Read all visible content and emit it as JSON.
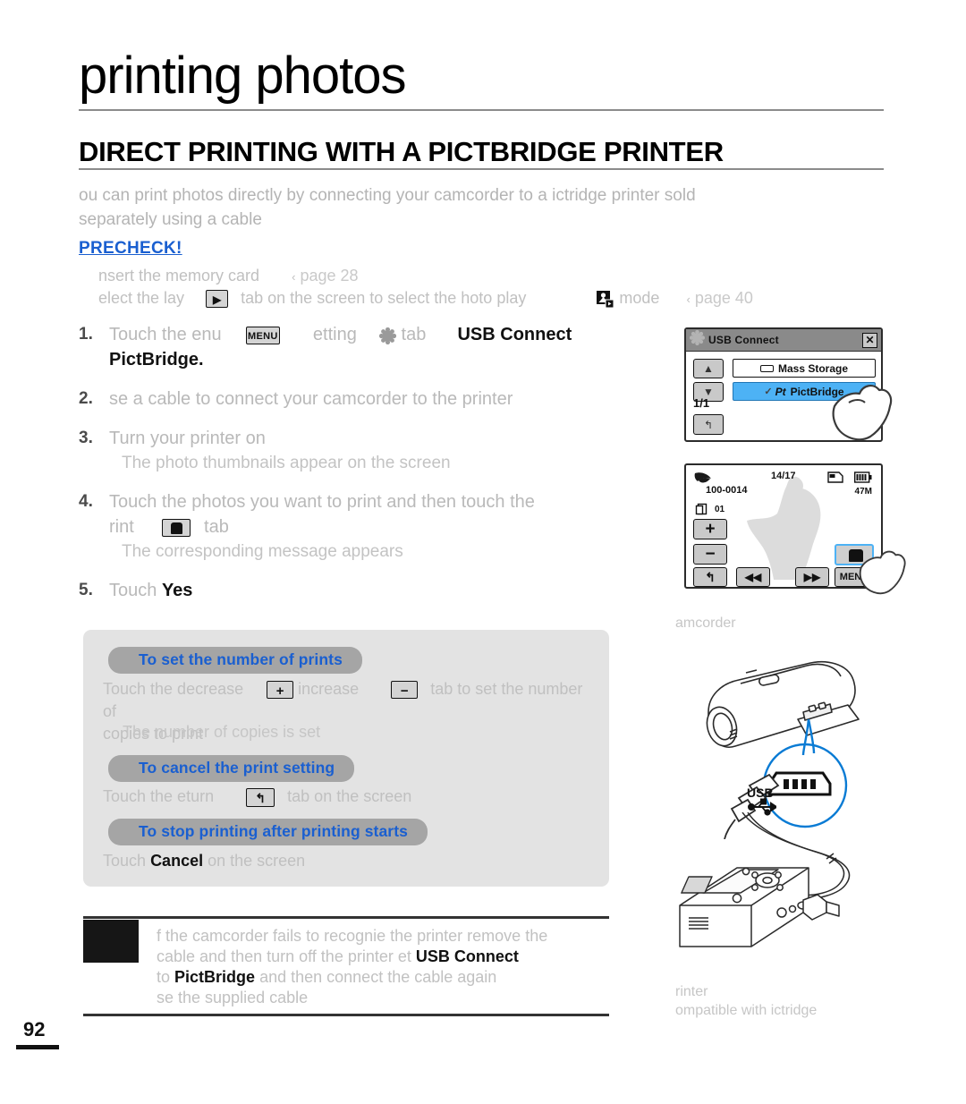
{
  "page": {
    "title": "printing photos",
    "section_title": "DIRECT PRINTING WITH A PICTBRIDGE PRINTER",
    "page_number": "92"
  },
  "intro": {
    "line1": "ou can print photos directly by connecting your camcorder to a ictridge printer sold",
    "line2": "separately using a  cable"
  },
  "precheck": {
    "label": "PRECHECK!",
    "items": [
      {
        "text": "nsert the memory card",
        "ref": "page 28",
        "icon": ""
      },
      {
        "text_before": "elect the lay",
        "icon": "play-tab-icon",
        "text_mid": "tab on the  screen to select the hoto play",
        "mode_icon": "photo-play-mode-icon",
        "text_after": "mode",
        "ref": "page 40"
      }
    ]
  },
  "steps": [
    {
      "num": "1.",
      "part1": "Touch the enu",
      "icon1": "menu-icon",
      "part2": "etting",
      "icon2": "settings-gear-icon",
      "part3": "tab",
      "bold1": "USB Connect",
      "bold2": "PictBridge."
    },
    {
      "num": "2.",
      "part1": "se a  cable to connect your camcorder to the printer"
    },
    {
      "num": "3.",
      "part1": "Turn your printer on",
      "sub": "The photo thumbnails appear on the  screen"
    },
    {
      "num": "4.",
      "part1": "Touch the photos you want to print and then touch the",
      "part2": "rint",
      "icon1": "print-tab-icon",
      "part3": "tab",
      "sub": "The corresponding message appears"
    },
    {
      "num": "5.",
      "part1": "Touch",
      "bold1": "Yes"
    }
  ],
  "infobox": {
    "blocks": [
      {
        "pill": "To set the number of prints",
        "line1a": "Touch the decrease",
        "icon1": "plus-tab-icon",
        "line1b": "increase",
        "icon2": "minus-tab-icon",
        "line1c": "tab to set the number of",
        "line2": "copies to print",
        "sub": "The number of copies is set"
      },
      {
        "pill": "To cancel the print setting",
        "line1a": "Touch the eturn",
        "icon1": "return-tab-icon",
        "line1b": "tab on the  screen"
      },
      {
        "pill": "To stop printing after printing starts",
        "line1a": "Touch",
        "bold": "Cancel",
        "line1b": "on the screen"
      }
    ]
  },
  "note": {
    "line1": "f the camcorder fails to recognie the printer remove the",
    "line2a": " cable and then turn off the printer et",
    "line2b": "USB Connect",
    "line3a": "to",
    "line3b": "PictBridge",
    "line3c": "and then connect the  cable again",
    "line4": "se the supplied  cable"
  },
  "usb_dialog": {
    "title": "USB Connect",
    "close_label": "✕",
    "up_label": "▲",
    "down_label": "▼",
    "page_indicator": "1/1",
    "return_label": "↰",
    "items": [
      {
        "label": "Mass Storage",
        "selected": false
      },
      {
        "label": "PictBridge",
        "selected": true
      }
    ]
  },
  "photo_lcd": {
    "counter": "14/17",
    "file_no": "100-0014",
    "copies": "01",
    "memory": "47M",
    "plus_label": "+",
    "minus_label": "−",
    "return_label": "↰",
    "prev_label": "◀◀",
    "next_label": "▶▶",
    "menu_label": "MENU"
  },
  "illustrations": {
    "camcorder_caption": "amcorder",
    "usb_label": "USB",
    "printer_caption_line1": "rinter",
    "printer_caption_line2": "ompatible with ictridge"
  },
  "colors": {
    "accent_blue": "#1a5fd0",
    "highlight_blue": "#4db2f5",
    "pill_gray": "#a5a5a5",
    "box_gray": "#e3e3e3",
    "body_gray": "#c0c0c0"
  }
}
